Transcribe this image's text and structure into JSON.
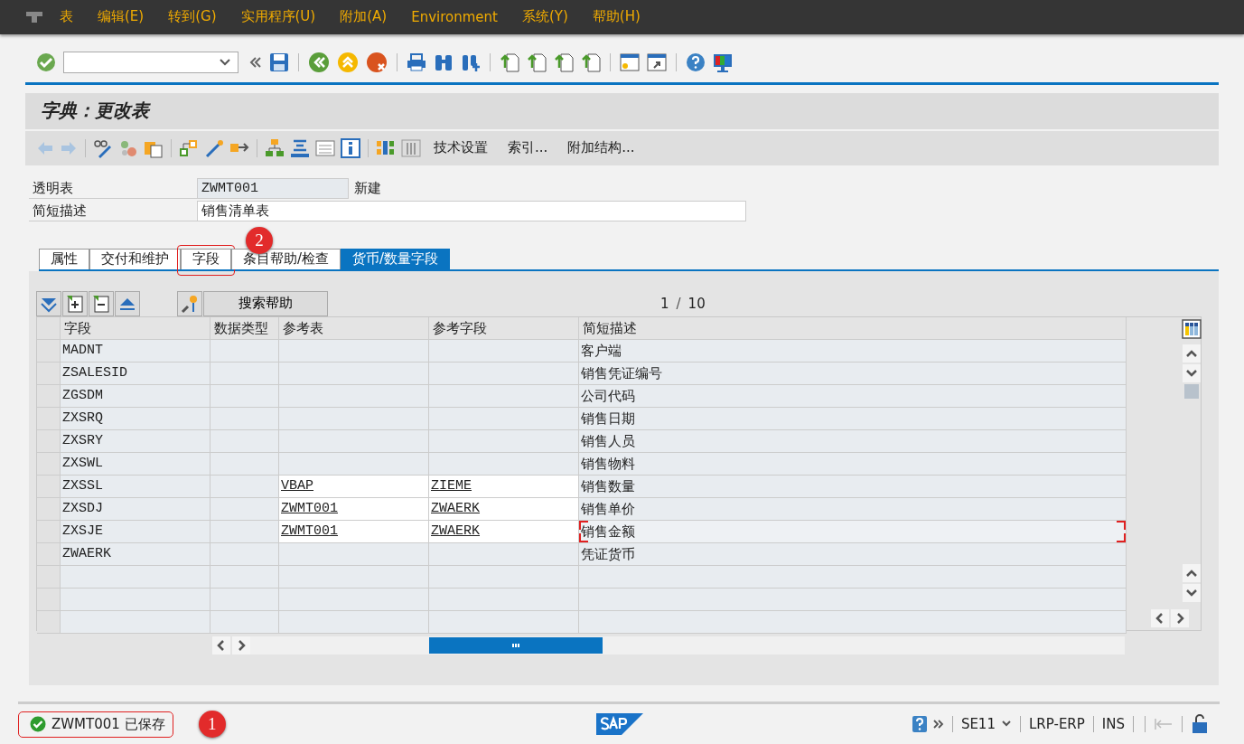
{
  "menu_bar": {
    "items": [
      "表",
      "编辑(E)",
      "转到(G)",
      "实用程序(U)",
      "附加(A)",
      "Environment",
      "系统(Y)",
      "帮助(H)"
    ]
  },
  "title": "字典：更改表",
  "app_toolbar": {
    "buttons": [
      "技术设置",
      "索引...",
      "附加结构..."
    ]
  },
  "header_fields": [
    {
      "label": "透明表",
      "value": "ZWMT001",
      "readonly": true,
      "status": "新建"
    },
    {
      "label": "简短描述",
      "value": "销售清单表",
      "readonly": false
    }
  ],
  "tabs": [
    {
      "label": "属性",
      "selected": false
    },
    {
      "label": "交付和维护",
      "selected": false
    },
    {
      "label": "字段",
      "selected": false,
      "callout": "2"
    },
    {
      "label": "条目帮助/检查",
      "selected": false
    },
    {
      "label": "货币/数量字段",
      "selected": true
    }
  ],
  "table_toolbar": {
    "search_help_button": "搜索帮助",
    "page": {
      "current": "1",
      "separator": "/",
      "total": "10"
    }
  },
  "table": {
    "columns": [
      "字段",
      "数据类型",
      "参考表",
      "参考字段",
      "简短描述"
    ],
    "rows": [
      {
        "cells": [
          "MADNT",
          "",
          "",
          "",
          "客户端"
        ],
        "editable": false,
        "focused": false
      },
      {
        "cells": [
          "ZSALESID",
          "",
          "",
          "",
          "销售凭证编号"
        ],
        "editable": false,
        "focused": false
      },
      {
        "cells": [
          "ZGSDM",
          "",
          "",
          "",
          "公司代码"
        ],
        "editable": false,
        "focused": false
      },
      {
        "cells": [
          "ZXSRQ",
          "",
          "",
          "",
          "销售日期"
        ],
        "editable": false,
        "focused": false
      },
      {
        "cells": [
          "ZXSRY",
          "",
          "",
          "",
          "销售人员"
        ],
        "editable": false,
        "focused": false
      },
      {
        "cells": [
          "ZXSWL",
          "",
          "",
          "",
          "销售物料"
        ],
        "editable": false,
        "focused": false
      },
      {
        "cells": [
          "ZXSSL",
          "",
          "VBAP",
          "ZIEME",
          "销售数量"
        ],
        "editable": true,
        "focused": false
      },
      {
        "cells": [
          "ZXSDJ",
          "",
          "ZWMT001",
          "ZWAERK",
          "销售单价"
        ],
        "editable": true,
        "focused": false
      },
      {
        "cells": [
          "ZXSJE",
          "",
          "ZWMT001",
          "ZWAERK",
          "销售金额"
        ],
        "editable": true,
        "focused": true
      },
      {
        "cells": [
          "ZWAERK",
          "",
          "",
          "",
          "凭证货币"
        ],
        "editable": false,
        "focused": false
      }
    ]
  },
  "status_bar": {
    "message": {
      "kind": "success",
      "text": "ZWMT001 已保存",
      "callout": "1"
    },
    "transaction": "SE11",
    "system": "LRP-ERP",
    "mode": "INS"
  }
}
